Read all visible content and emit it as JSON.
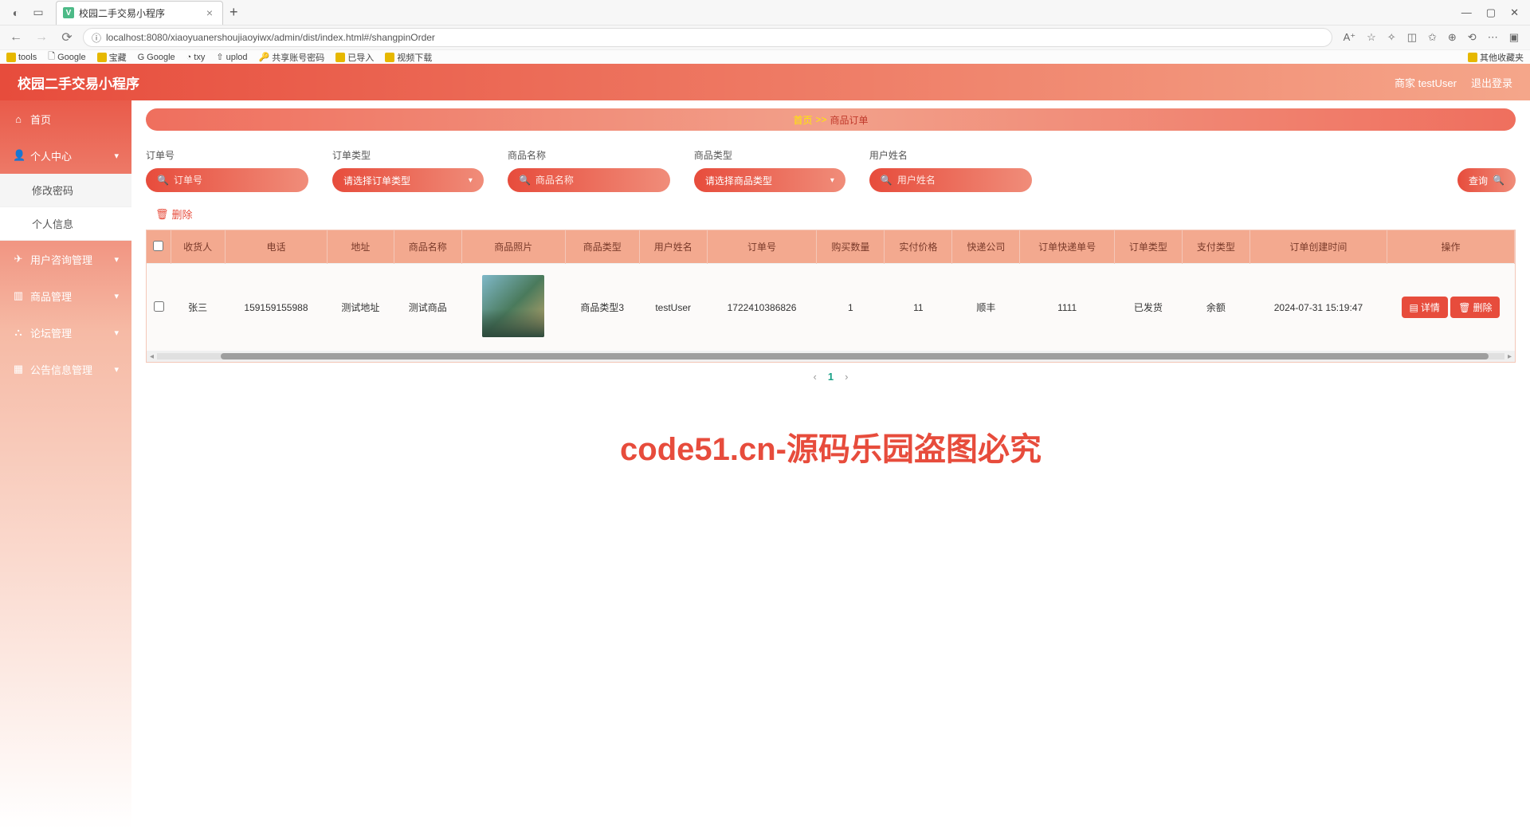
{
  "browser": {
    "tab_title": "校园二手交易小程序",
    "url": "localhost:8080/xiaoyuanershoujiaoyiwx/admin/dist/index.html#/shangpinOrder",
    "bookmarks": [
      "tools",
      "Google",
      "宝藏",
      "Google",
      "txy",
      "uplod",
      "共享账号密码",
      "已导入",
      "视频下载"
    ],
    "bookmarks_right": "其他收藏夹"
  },
  "header": {
    "logo": "校园二手交易小程序",
    "user_label": "商家 testUser",
    "logout": "退出登录"
  },
  "sidebar": {
    "home": "首页",
    "items": [
      {
        "label": "个人中心",
        "children": [
          "修改密码",
          "个人信息"
        ]
      },
      {
        "label": "用户咨询管理"
      },
      {
        "label": "商品管理"
      },
      {
        "label": "论坛管理"
      },
      {
        "label": "公告信息管理"
      }
    ]
  },
  "breadcrumb": {
    "home": "首页",
    "sep": ">>",
    "current": "商品订单"
  },
  "filters": {
    "order_no": {
      "label": "订单号",
      "placeholder": "订单号"
    },
    "order_type": {
      "label": "订单类型",
      "placeholder": "请选择订单类型"
    },
    "product_name": {
      "label": "商品名称",
      "placeholder": "商品名称"
    },
    "product_type": {
      "label": "商品类型",
      "placeholder": "请选择商品类型"
    },
    "user_name": {
      "label": "用户姓名",
      "placeholder": "用户姓名"
    },
    "search_btn": "查询"
  },
  "actions": {
    "delete": "删除"
  },
  "table": {
    "columns": [
      "",
      "收货人",
      "电话",
      "地址",
      "商品名称",
      "商品照片",
      "商品类型",
      "用户姓名",
      "订单号",
      "购买数量",
      "实付价格",
      "快递公司",
      "订单快递单号",
      "订单类型",
      "支付类型",
      "订单创建时间",
      "操作"
    ],
    "row": {
      "receiver": "张三",
      "phone": "159159155988",
      "address": "测试地址",
      "product": "测试商品",
      "ptype": "商品类型3",
      "uname": "testUser",
      "ono": "1722410386826",
      "qty": "1",
      "price": "11",
      "courier": "顺丰",
      "cnum": "1111",
      "otype": "已发货",
      "ptype2": "余额",
      "ctime": "2024-07-31 15:19:47",
      "op_detail": "详情",
      "op_delete": "删除"
    }
  },
  "pager": {
    "page": "1"
  },
  "watermark": "code51.cn-源码乐园盗图必究"
}
